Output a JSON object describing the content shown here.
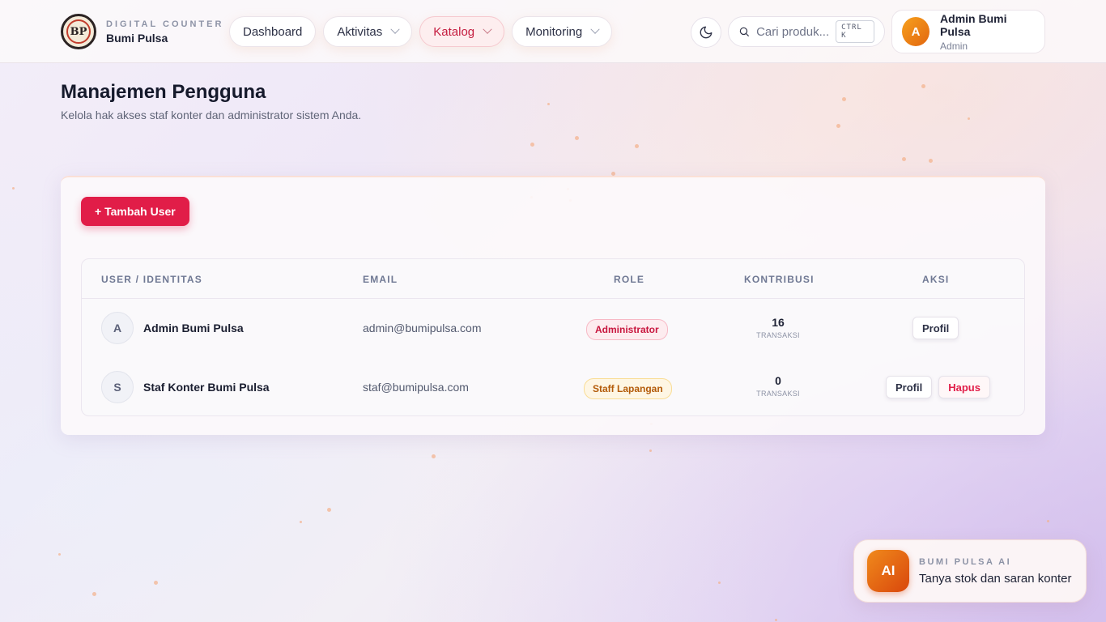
{
  "brand": {
    "logo_text": "BP",
    "subtitle": "DIGITAL COUNTER",
    "name": "Bumi Pulsa"
  },
  "nav": {
    "items": [
      {
        "label": "Dashboard",
        "has_dropdown": false,
        "active": false
      },
      {
        "label": "Aktivitas",
        "has_dropdown": true,
        "active": false
      },
      {
        "label": "Katalog",
        "has_dropdown": true,
        "active": true
      },
      {
        "label": "Monitoring",
        "has_dropdown": true,
        "active": false
      }
    ]
  },
  "header": {
    "theme_icon": "moon-icon",
    "search_placeholder": "Cari produk...",
    "search_shortcut": "CTRL K",
    "user": {
      "initial": "A",
      "name": "Admin Bumi Pulsa",
      "role": "Admin"
    }
  },
  "page": {
    "title": "Manajemen Pengguna",
    "subtitle": "Kelola hak akses staf konter dan administrator sistem Anda."
  },
  "toolbar": {
    "add_user_label": "+ Tambah User"
  },
  "table": {
    "headers": {
      "user": "USER / IDENTITAS",
      "email": "EMAIL",
      "role": "ROLE",
      "kontribusi": "KONTRIBUSI",
      "aksi": "AKSI"
    },
    "rows": [
      {
        "initial": "A",
        "name": "Admin Bumi Pulsa",
        "email": "admin@bumipulsa.com",
        "role": "Administrator",
        "contributions": "16",
        "contributions_unit": "TRANSAKSI",
        "actions": [
          "Profil"
        ]
      },
      {
        "initial": "S",
        "name": "Staf Konter Bumi Pulsa",
        "email": "staf@bumipulsa.com",
        "role": "Staff Lapangan",
        "contributions": "0",
        "contributions_unit": "TRANSAKSI",
        "actions": [
          "Profil",
          "Hapus"
        ]
      }
    ]
  },
  "ai_widget": {
    "icon_text": "AI",
    "label": "BUMI PULSA AI",
    "description": "Tanya stok dan saran konter"
  },
  "colors": {
    "accent": "#e11d48",
    "admin_badge": "#c8163e",
    "staff_badge": "#b35a08",
    "avatar_gradient_start": "#f7a11d",
    "avatar_gradient_end": "#e2660f"
  }
}
